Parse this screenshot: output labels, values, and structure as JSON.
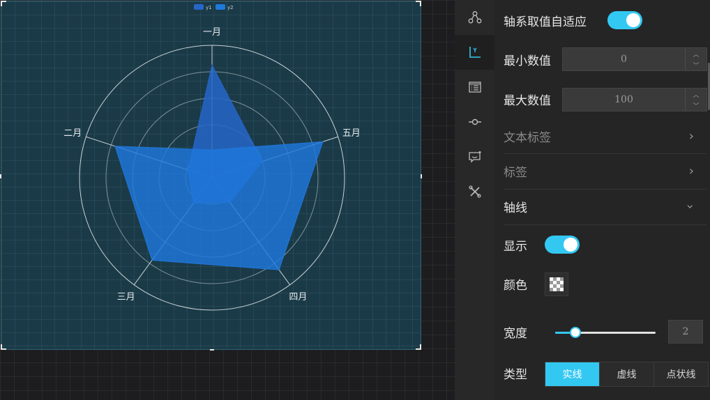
{
  "chart_data": {
    "type": "radar",
    "legend": [
      "y1",
      "y2"
    ],
    "legend_position": "top-center",
    "indicators": [
      "一月",
      "五月",
      "四月",
      "三月",
      "二月"
    ],
    "rlim": [
      0,
      100
    ],
    "ring_count": 5,
    "series": [
      {
        "name": "y1",
        "values": [
          85,
          40,
          23,
          24,
          19
        ],
        "color": "#2566c8"
      },
      {
        "name": "y2",
        "values": [
          21,
          88,
          86,
          77,
          77
        ],
        "color": "#1f78dc"
      }
    ]
  },
  "rail": {
    "items": [
      {
        "icon": "share-nodes-icon"
      },
      {
        "icon": "axis-y-icon"
      },
      {
        "icon": "list-doc-icon"
      },
      {
        "icon": "commit-node-icon"
      },
      {
        "icon": "chat-bubble-icon"
      },
      {
        "icon": "tools-icon"
      }
    ],
    "active_index": 1
  },
  "panel": {
    "adaptive_label": "轴系取值自适应",
    "adaptive_on": true,
    "min_label": "最小数值",
    "min_value": "0",
    "max_label": "最大数值",
    "max_value": "100",
    "text_label_section": "文本标签",
    "label_section": "标签",
    "axis_line_section": "轴线",
    "show_label": "显示",
    "show_on": true,
    "color_label": "颜色",
    "width_label": "宽度",
    "width_value": "2",
    "width_slider_fraction": 0.2,
    "type_label": "类型",
    "type_options": [
      "实线",
      "虚线",
      "点状线"
    ],
    "type_selected": "实线"
  },
  "colors": {
    "accent": "#33c8f2",
    "panel_bg": "#1b3a47"
  }
}
